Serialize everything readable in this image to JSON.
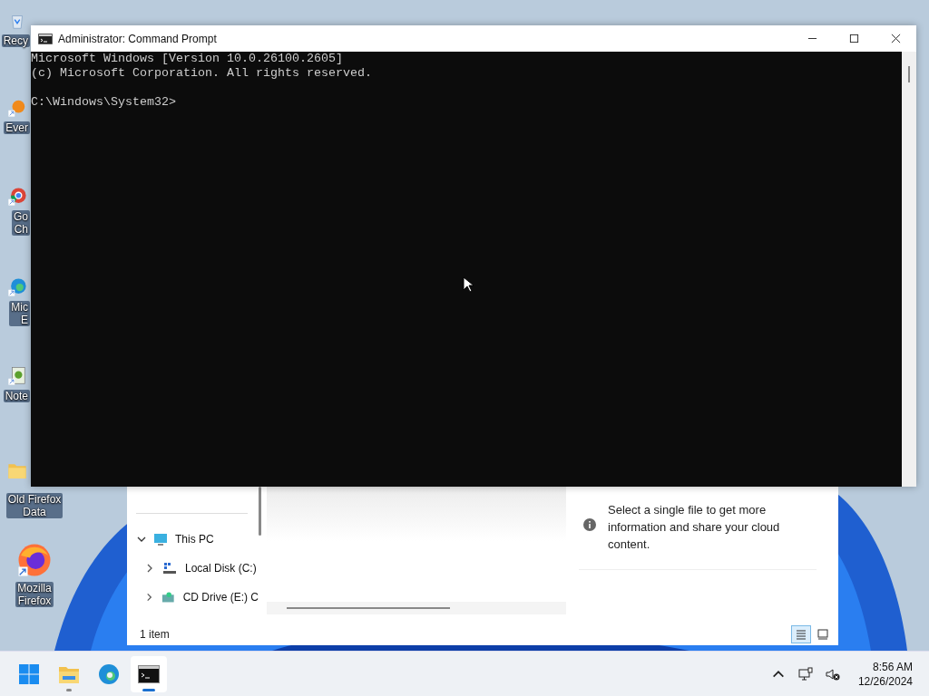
{
  "desktop_icons": [
    {
      "kind": "recycle",
      "covered": true,
      "label_lines": [
        "Recy"
      ]
    },
    {
      "kind": "everything",
      "covered": true,
      "label_lines": [
        "Ever"
      ]
    },
    {
      "kind": "chrome",
      "covered": true,
      "label_lines": [
        "Go",
        "Ch"
      ]
    },
    {
      "kind": "edge",
      "covered": true,
      "label_lines": [
        "Mic",
        "E"
      ]
    },
    {
      "kind": "notepad",
      "covered": true,
      "label_lines": [
        "Note"
      ]
    },
    {
      "kind": "folder",
      "covered": false,
      "label_lines": [
        "Old Firefox",
        "Data"
      ]
    },
    {
      "kind": "firefox",
      "covered": false,
      "label_lines": [
        "Mozilla",
        "Firefox"
      ]
    }
  ],
  "console_window": {
    "title": "Administrator: Command Prompt",
    "output": [
      "Microsoft Windows [Version 10.0.26100.2605]",
      "(c) Microsoft Corporation. All rights reserved."
    ],
    "prompt": "C:\\Windows\\System32>"
  },
  "explorer": {
    "nav_items": [
      {
        "label": "This PC",
        "kind": "pc",
        "expanded": true,
        "children": [
          {
            "label": "Local Disk (C:)",
            "kind": "disk",
            "expanded": false
          },
          {
            "label": "CD Drive (E:) C",
            "kind": "cd",
            "expanded": false
          }
        ]
      }
    ],
    "details_message": "Select a single file to get more information and share your cloud content.",
    "status": "1 item",
    "views": [
      {
        "kind": "details",
        "selected": true
      },
      {
        "kind": "tiles",
        "selected": false
      }
    ]
  },
  "taskbar": {
    "apps": [
      {
        "kind": "start",
        "running": false,
        "active": false
      },
      {
        "kind": "explorer",
        "running": true,
        "active": false
      },
      {
        "kind": "edge",
        "running": false,
        "active": false
      },
      {
        "kind": "terminal",
        "running": true,
        "active": true
      }
    ],
    "time": "8:56 AM",
    "date": "12/26/2024"
  }
}
